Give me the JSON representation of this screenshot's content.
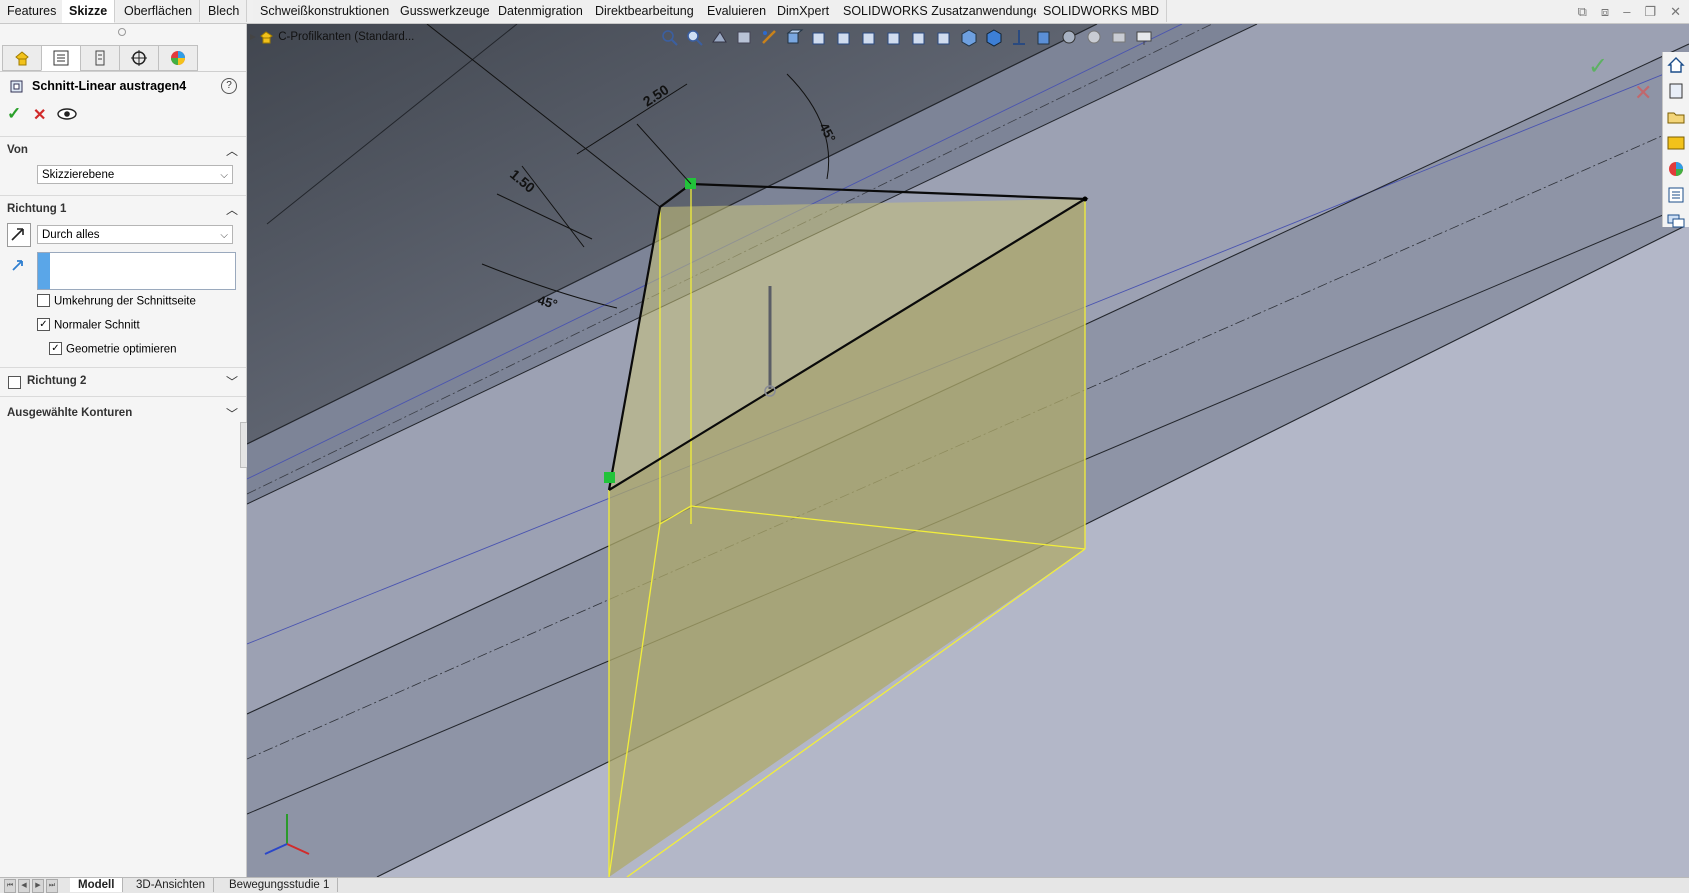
{
  "tabs": [
    "Features",
    "Skizze",
    "Oberflächen",
    "Blech",
    "Schweißkonstruktionen",
    "Gusswerkzeuge",
    "Datenmigration",
    "Direktbearbeitung",
    "Evaluieren",
    "DimXpert",
    "SOLIDWORKS Zusatzanwendungen",
    "SOLIDWORKS MBD"
  ],
  "active_tab": "Skizze",
  "property_manager": {
    "title": "Schnitt-Linear austragen4",
    "von": {
      "label": "Von",
      "value": "Skizzierebene"
    },
    "richtung1": {
      "label": "Richtung 1",
      "end_condition": "Durch alles",
      "direction_value": ""
    },
    "options": {
      "flip_side": {
        "label": "Umkehrung der Schnittseite",
        "checked": false
      },
      "normal_cut": {
        "label": "Normaler Schnitt",
        "checked": true
      },
      "optimize": {
        "label": "Geometrie optimieren",
        "checked": true
      }
    },
    "richtung2": {
      "label": "Richtung 2",
      "checked": false
    },
    "contours": {
      "label": "Ausgewählte Konturen"
    }
  },
  "feature_tree": {
    "root": "C-Profilkanten  (Standard..."
  },
  "dimensions": {
    "d1": "2.50",
    "d2": "1.50",
    "a1": "45°",
    "a2": "45°"
  },
  "bottom_tabs": [
    "Modell",
    "3D-Ansichten",
    "Bewegungsstudie 1"
  ],
  "active_bottom_tab": "Modell",
  "colors": {
    "accent_check": "#2aa02a",
    "accent_cancel": "#d12a2a",
    "preview_fill": "#c8c27a",
    "preview_edge": "#f2ee3a",
    "sketch_point": "#22c33a"
  }
}
